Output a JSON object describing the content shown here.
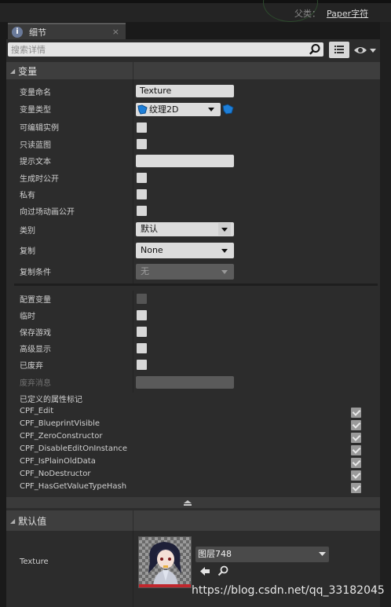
{
  "header": {
    "parent_label": "父类：",
    "parent_value": "Paper字符"
  },
  "tab": {
    "label": "细节",
    "close": "×",
    "icon": "details-icon"
  },
  "search": {
    "placeholder": "搜索详情"
  },
  "variables_section": {
    "title": "变量",
    "rows": [
      {
        "label": "变量命名",
        "value": "Texture"
      },
      {
        "label": "变量类型",
        "value": "纹理2D"
      },
      {
        "label": "可编辑实例",
        "checked": false
      },
      {
        "label": "只读蓝图",
        "checked": false
      },
      {
        "label": "提示文本",
        "value": ""
      },
      {
        "label": "生成时公开",
        "checked": false
      },
      {
        "label": "私有",
        "checked": false
      },
      {
        "label": "向过场动画公开",
        "checked": false
      },
      {
        "label": "类别",
        "value": "默认"
      },
      {
        "label": "复制",
        "value": "None"
      },
      {
        "label": "复制条件",
        "value": "无",
        "disabled": true
      }
    ],
    "advanced_rows": [
      {
        "label": "配置变量",
        "checked": false,
        "disabled": true
      },
      {
        "label": "临时",
        "checked": false
      },
      {
        "label": "保存游戏",
        "checked": false
      },
      {
        "label": "高级显示",
        "checked": false
      },
      {
        "label": "已废弃",
        "checked": false
      },
      {
        "label": "废弃消息",
        "value": "",
        "disabled": true
      }
    ],
    "flags_label": "已定义的属性标记",
    "flags": [
      "CPF_Edit",
      "CPF_BlueprintVisible",
      "CPF_ZeroConstructor",
      "CPF_DisableEditOnInstance",
      "CPF_IsPlainOldData",
      "CPF_NoDestructor",
      "CPF_HasGetValueTypeHash"
    ]
  },
  "defaults_section": {
    "title": "默认值",
    "texture_label": "Texture",
    "asset_name": "图层748"
  },
  "watermark": "https://blog.csdn.net/qq_33182045",
  "colors": {
    "panel": "#2c2c2c",
    "header": "#3e3e3e",
    "field": "#dcdcdc",
    "thumb_bar": "#c0272d",
    "type_icon": "#1e7fd8"
  }
}
